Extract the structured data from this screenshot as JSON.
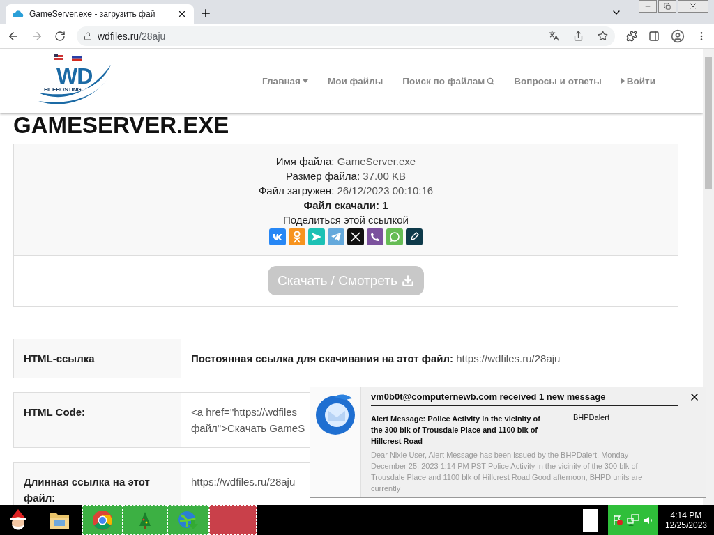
{
  "browser": {
    "tab_title": "GameServer.exe - загрузить фай",
    "url_host": "wdfiles.ru",
    "url_path": "/28aju"
  },
  "site": {
    "logo_text": "WD",
    "logo_subtext": "FILEHOSTING",
    "nav": [
      {
        "label": "Главная",
        "kind": "dropdown"
      },
      {
        "label": "Мои файлы",
        "kind": "plain"
      },
      {
        "label": "Поиск по файлам",
        "kind": "search"
      },
      {
        "label": "Вопросы и ответы",
        "kind": "plain"
      },
      {
        "label": "Войти",
        "kind": "arrow"
      }
    ]
  },
  "page_title": "GAMESERVER.EXE",
  "file_info": [
    {
      "label": "Имя файла:",
      "value": "GameServer.exe",
      "kind": "pair"
    },
    {
      "label": "Размер файла:",
      "value": "37.00 KB",
      "kind": "pair"
    },
    {
      "label": "Файл загружен:",
      "value": "26/12/2023 00:10:16",
      "kind": "pair"
    },
    {
      "label": "Файл скачали:",
      "value": "1",
      "kind": "bold"
    }
  ],
  "share_label": "Поделиться этой ссылкой",
  "share_buttons": [
    {
      "kind": "vk",
      "color": "#2787f5"
    },
    {
      "kind": "ok",
      "color": "#f7931e"
    },
    {
      "kind": "send",
      "color": "#1cc1b5"
    },
    {
      "kind": "telegram",
      "color": "#64a9dc"
    },
    {
      "kind": "x",
      "color": "#111111"
    },
    {
      "kind": "viber",
      "color": "#7b519d"
    },
    {
      "kind": "whatsapp",
      "color": "#65bc54"
    },
    {
      "kind": "pen",
      "color": "#0e3a4a"
    }
  ],
  "download_button": {
    "label": "Скачать / Смотреть",
    "disabled": true
  },
  "link_rows": [
    {
      "label": "HTML-ссылка",
      "lines": [
        "**Постоянная ссылка для скачивания на этот файл:** https://wdfiles.ru/28aju"
      ]
    },
    {
      "label": "HTML Code:",
      "lines": [
        "<a href=\"https://wdfiles",
        "файл\">Скачать GameS"
      ]
    },
    {
      "label": "Длинная ссылка на этот файл:",
      "lines": [
        "https://wdfiles.ru/28aju"
      ]
    }
  ],
  "notification": {
    "title": "vm0b0t@computernewb.com received 1 new message",
    "subject": "Alert Message: Police Activity in the vicinity of the 300 blk of Trousdale Place and 1100 blk of Hillcrest Road",
    "sender": "BHPDalert",
    "body": "Dear Nixle User, Alert Message has been issued by the BHPDalert. Monday December 25, 2023 1:14 PM PST Police Activity in the vicinity of the 300 blk of Trousdale Place and 1100 blk of Hillcrest Road Good afternoon, BHPD units are currently"
  },
  "taskbar": {
    "time": "4:14 PM",
    "date": "12/25/2023"
  }
}
